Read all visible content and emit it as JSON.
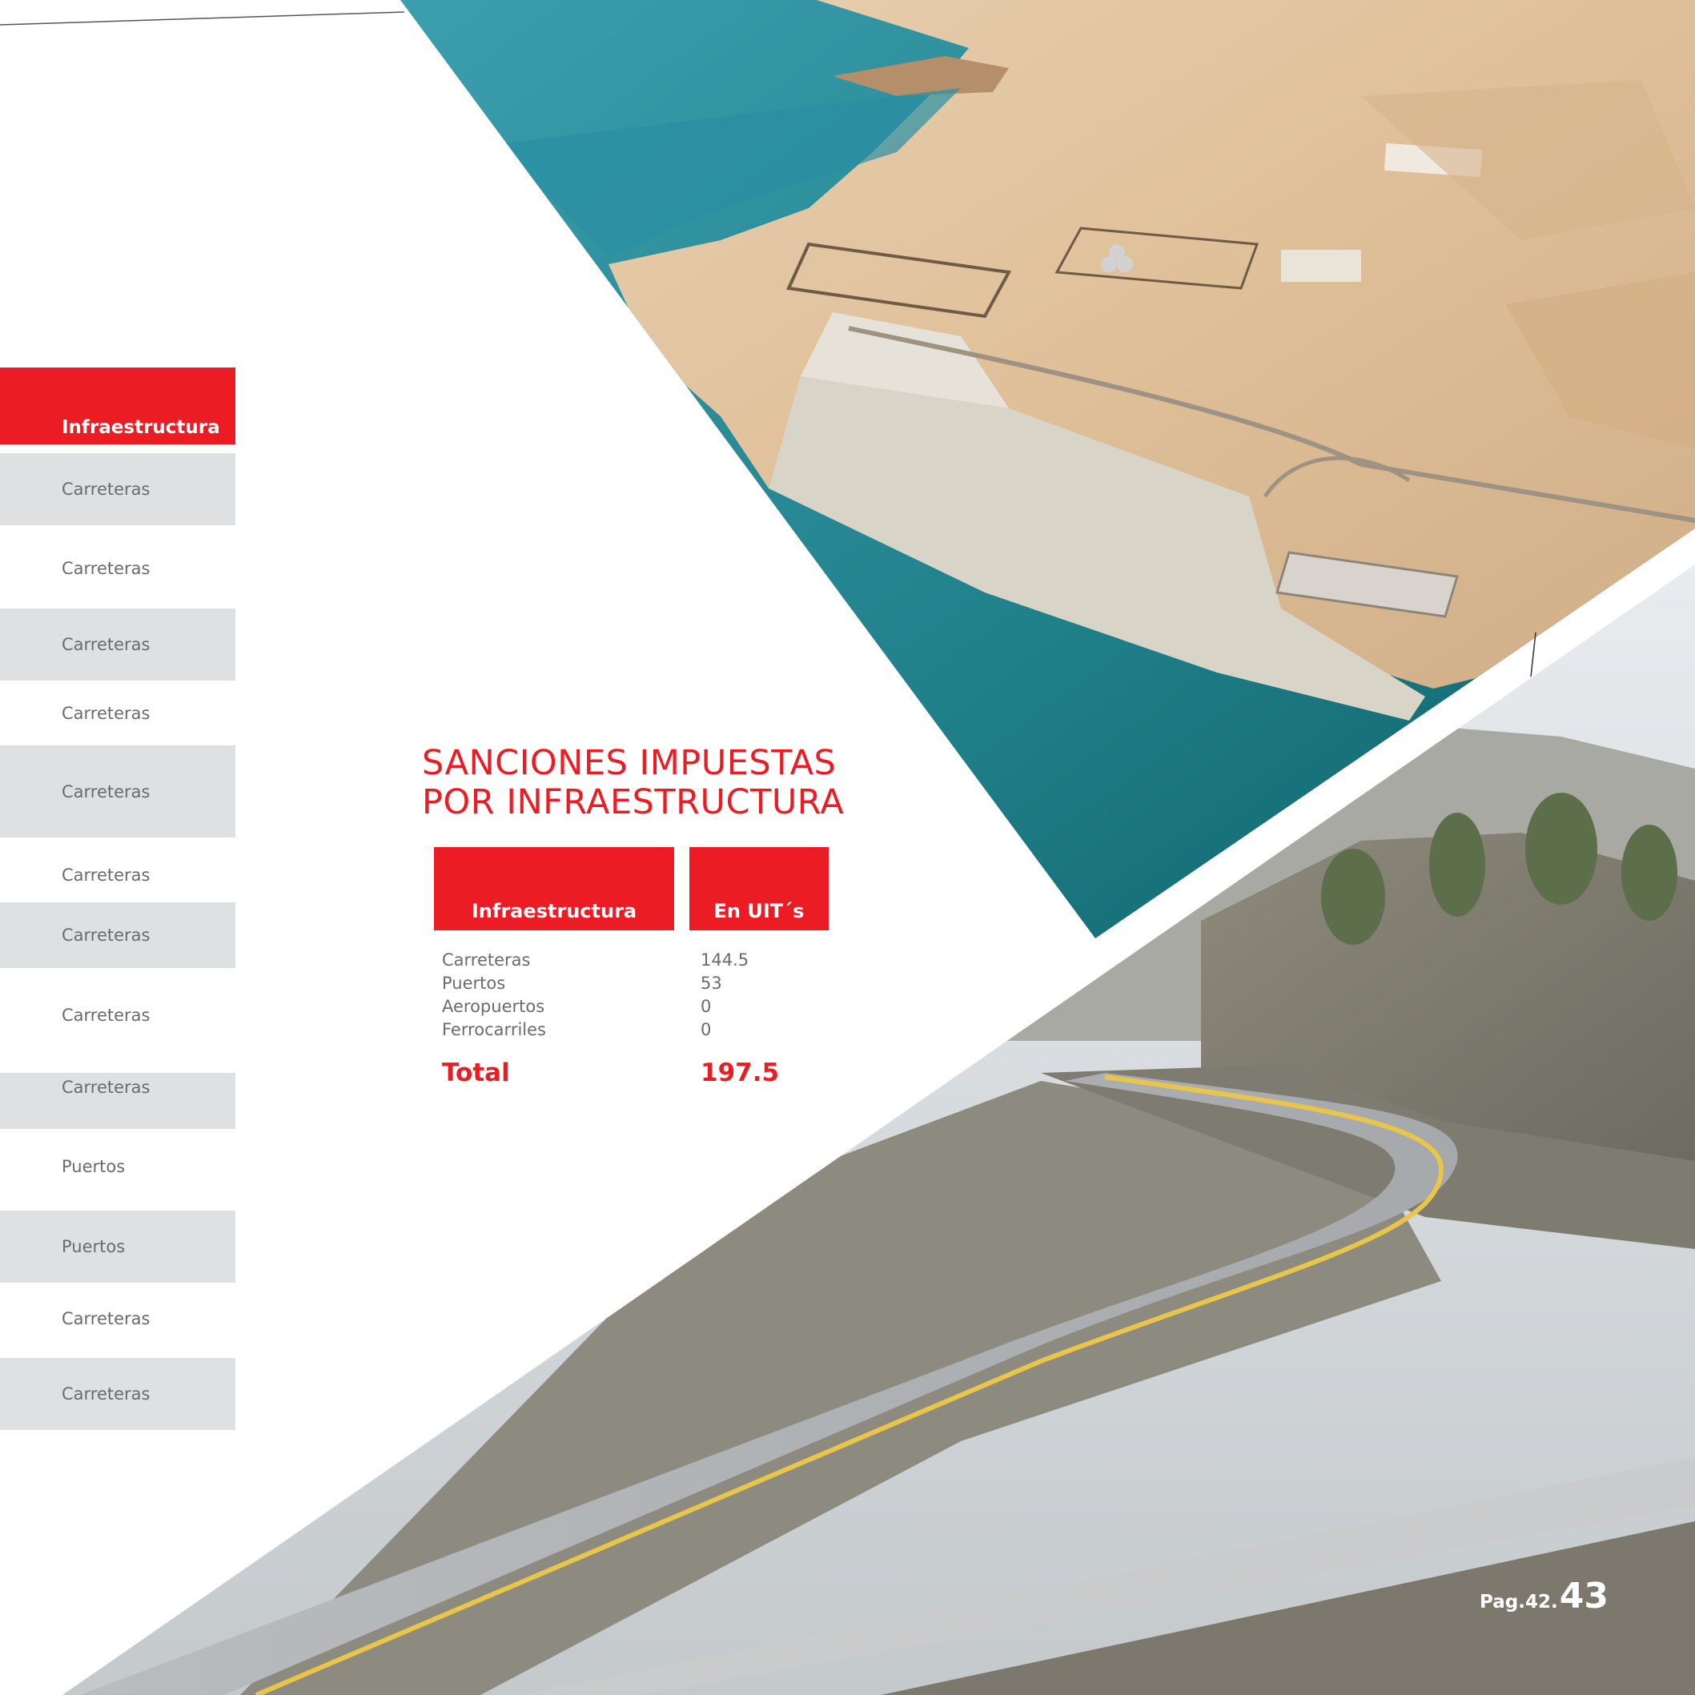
{
  "sidebar": {
    "header": "Infraestructura",
    "items": [
      {
        "label": "Carreteras",
        "shaded": true
      },
      {
        "label": "Carreteras",
        "shaded": false
      },
      {
        "label": "Carreteras",
        "shaded": true
      },
      {
        "label": "Carreteras",
        "shaded": false
      },
      {
        "label": "Carreteras",
        "shaded": true
      },
      {
        "label": "Carreteras",
        "shaded": false
      },
      {
        "label": "Carreteras",
        "shaded": true
      },
      {
        "label": "Carreteras",
        "shaded": false
      },
      {
        "label": "Carreteras",
        "shaded": true
      },
      {
        "label": "Puertos",
        "shaded": false
      },
      {
        "label": "Puertos",
        "shaded": true
      },
      {
        "label": "Carreteras",
        "shaded": false
      },
      {
        "label": "Carreteras",
        "shaded": true
      }
    ]
  },
  "section": {
    "title_line1": "SANCIONES IMPUESTAS",
    "title_line2": "POR INFRAESTRUCTURA"
  },
  "table": {
    "headers": [
      "Infraestructura",
      "En UIT´s"
    ],
    "rows": [
      {
        "name": "Carreteras",
        "value": "144.5"
      },
      {
        "name": "Puertos",
        "value": "53"
      },
      {
        "name": "Aeropuertos",
        "value": "0"
      },
      {
        "name": "Ferrocarriles",
        "value": "0"
      }
    ],
    "total_label": "Total",
    "total_value": "197.5"
  },
  "footer": {
    "page_prefix": "Pag.42.",
    "page_number": "43"
  },
  "colors": {
    "accent": "#ec1c24",
    "row_shade": "#dfe0e1",
    "text_grey": "#6b6b6b"
  }
}
